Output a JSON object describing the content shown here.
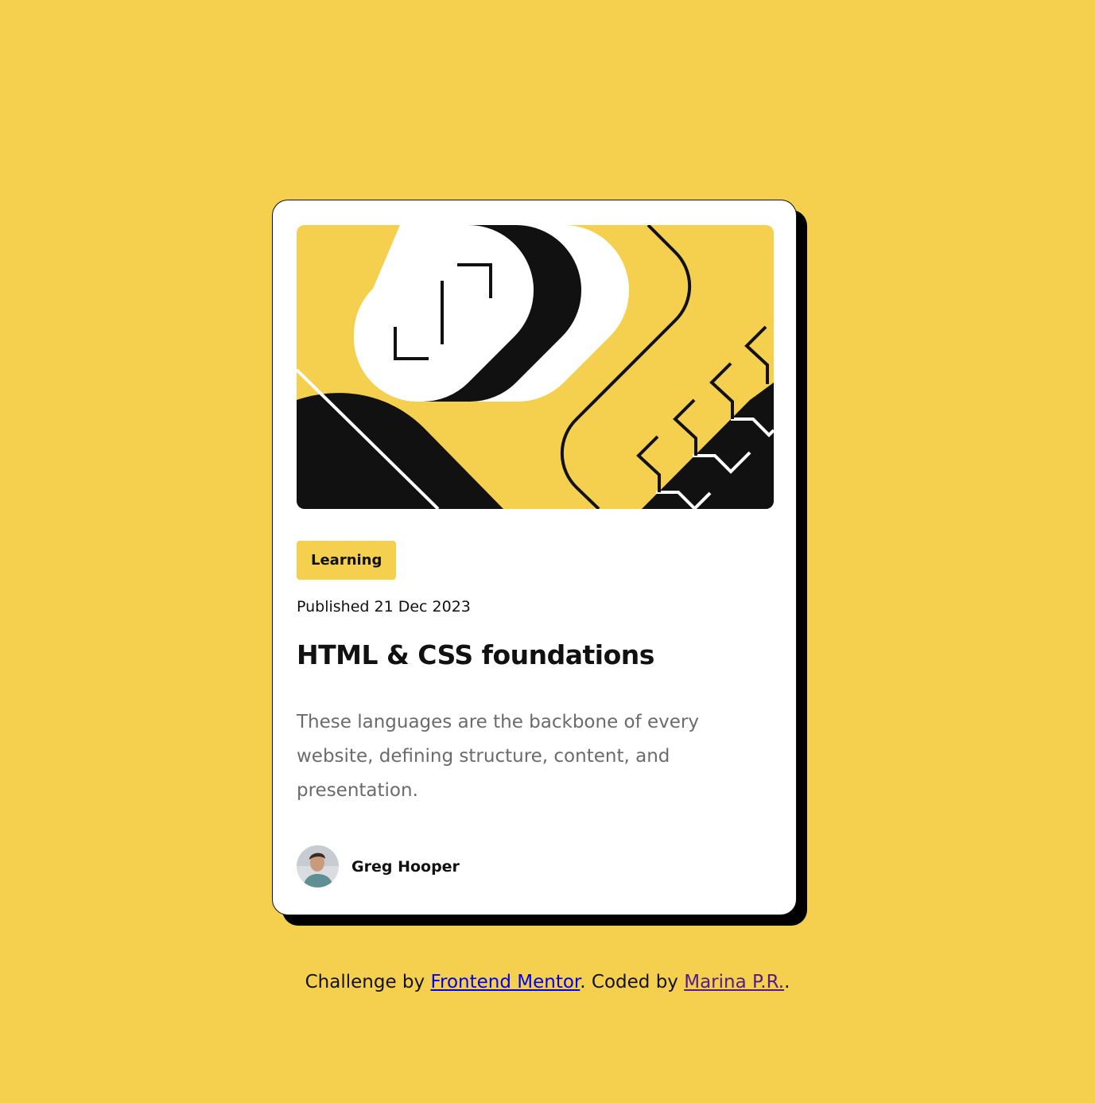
{
  "colors": {
    "page_background": "#f4d04e",
    "card_background": "#ffffff",
    "text_dark": "#111111",
    "text_muted": "#6b6b6b",
    "link": "#0000ee",
    "visited_link": "#551a8b"
  },
  "card": {
    "hero_image": "html-css-illustration",
    "tag": "Learning",
    "published": "Published 21 Dec 2023",
    "title": "HTML & CSS foundations",
    "description": "These languages are the backbone of every website, defining structure, content, and presentation.",
    "author": {
      "avatar": "avatar-photo",
      "name": "Greg Hooper"
    }
  },
  "attribution": {
    "prefix": "Challenge by ",
    "challenge_link": "Frontend Mentor",
    "middle": ". Coded by ",
    "author_link": "Marina P.R.",
    "suffix": "."
  }
}
